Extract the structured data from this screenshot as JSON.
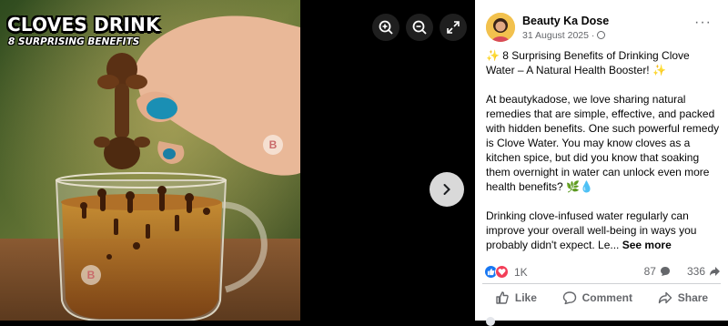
{
  "media": {
    "overlay_title": "CLOVES DRINK",
    "overlay_subtitle": "8 SURPRISING BENEFITS",
    "watermark": "B",
    "tools": [
      "zoom-in-icon",
      "zoom-out-icon",
      "fullscreen-icon"
    ],
    "next_icon": "chevron-right-icon"
  },
  "post": {
    "page_name": "Beauty Ka Dose",
    "date": "31 August 2025 ·",
    "more_label": "···",
    "title_line": "✨ 8 Surprising Benefits of Drinking Clove Water – A Natural Health Booster! ✨",
    "paragraph_1": "At beautykadose, we love sharing natural remedies that are simple, effective, and packed with hidden benefits. One such powerful remedy is Clove Water. You may know cloves as a kitchen spice, but did you know that soaking them overnight in water can unlock even more health benefits? 🌿💧",
    "paragraph_2": "Drinking clove-infused water regularly can improve your overall well-being in ways you probably didn't expect. Le...",
    "see_more": "See more"
  },
  "stats": {
    "reactions": "1K",
    "comments": "87",
    "shares": "336"
  },
  "actions": {
    "like": "Like",
    "comment": "Comment",
    "share": "Share"
  },
  "colors": {
    "like_blue": "#1877f2",
    "love_red": "#f33e58",
    "tea": "#a4621a"
  }
}
